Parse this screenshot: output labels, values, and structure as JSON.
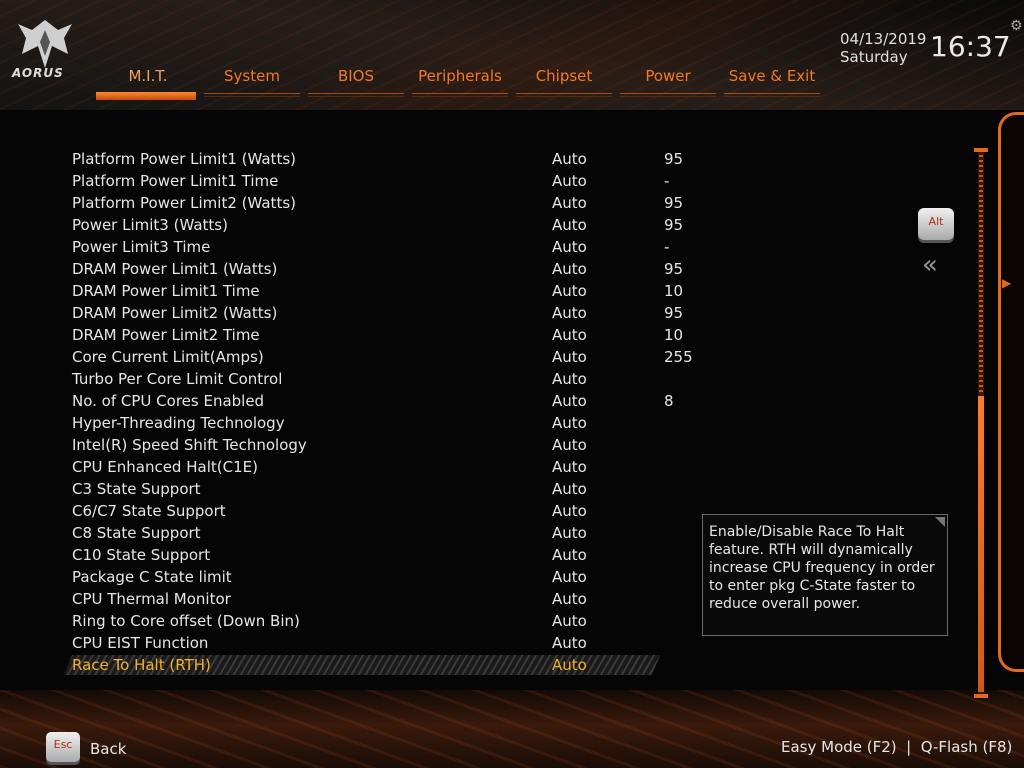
{
  "brand": {
    "logo_text": "AORUS"
  },
  "tabs": [
    "M.I.T.",
    "System",
    "BIOS",
    "Peripherals",
    "Chipset",
    "Power",
    "Save & Exit"
  ],
  "active_tab": "M.I.T.",
  "datetime": {
    "date": "04/13/2019",
    "day": "Saturday",
    "time": "16:37"
  },
  "settings": [
    {
      "label": "Platform Power Limit1 (Watts)",
      "value": "Auto",
      "current": "95"
    },
    {
      "label": "Platform Power Limit1 Time",
      "value": "Auto",
      "current": "-"
    },
    {
      "label": "Platform Power Limit2 (Watts)",
      "value": "Auto",
      "current": "95"
    },
    {
      "label": "Power Limit3 (Watts)",
      "value": "Auto",
      "current": "95"
    },
    {
      "label": "Power Limit3 Time",
      "value": "Auto",
      "current": "-"
    },
    {
      "label": "DRAM Power Limit1 (Watts)",
      "value": "Auto",
      "current": "95"
    },
    {
      "label": "DRAM Power Limit1 Time",
      "value": "Auto",
      "current": "10"
    },
    {
      "label": "DRAM Power Limit2 (Watts)",
      "value": "Auto",
      "current": "95"
    },
    {
      "label": "DRAM Power Limit2 Time",
      "value": "Auto",
      "current": "10"
    },
    {
      "label": "Core Current Limit(Amps)",
      "value": "Auto",
      "current": "255"
    },
    {
      "label": "Turbo Per Core Limit Control",
      "value": "Auto",
      "current": ""
    },
    {
      "label": "No. of CPU Cores Enabled",
      "value": "Auto",
      "current": "8"
    },
    {
      "label": "Hyper-Threading Technology",
      "value": "Auto",
      "current": ""
    },
    {
      "label": "Intel(R) Speed Shift Technology",
      "value": "Auto",
      "current": ""
    },
    {
      "label": "CPU Enhanced Halt(C1E)",
      "value": "Auto",
      "current": ""
    },
    {
      "label": "C3 State Support",
      "value": "Auto",
      "current": ""
    },
    {
      "label": "C6/C7 State Support",
      "value": "Auto",
      "current": ""
    },
    {
      "label": "C8 State Support",
      "value": "Auto",
      "current": ""
    },
    {
      "label": "C10 State Support",
      "value": "Auto",
      "current": ""
    },
    {
      "label": "Package C State limit",
      "value": "Auto",
      "current": ""
    },
    {
      "label": "CPU Thermal Monitor",
      "value": "Auto",
      "current": ""
    },
    {
      "label": "Ring to Core offset (Down Bin)",
      "value": "Auto",
      "current": ""
    },
    {
      "label": "CPU EIST Function",
      "value": "Auto",
      "current": ""
    },
    {
      "label": "Race To Halt (RTH)",
      "value": "Auto",
      "current": "",
      "selected": true
    }
  ],
  "help_text": "Enable/Disable Race To Halt feature. RTH will dynamically increase CPU frequency in order to enter pkg C-State faster to reduce overall power.",
  "keys": {
    "alt": "Alt",
    "esc": "Esc"
  },
  "footer": {
    "back": "Back",
    "right": "Easy Mode (F2)  |  Q-Flash (F8)"
  },
  "colors": {
    "accent": "#f07a2a",
    "selected_text": "#f2b02c"
  },
  "icons": {
    "logo": "aorus-eagle-icon",
    "gear": "gear-icon",
    "collapse": "double-chevron-left-icon",
    "expand": "chevron-right-icon"
  }
}
